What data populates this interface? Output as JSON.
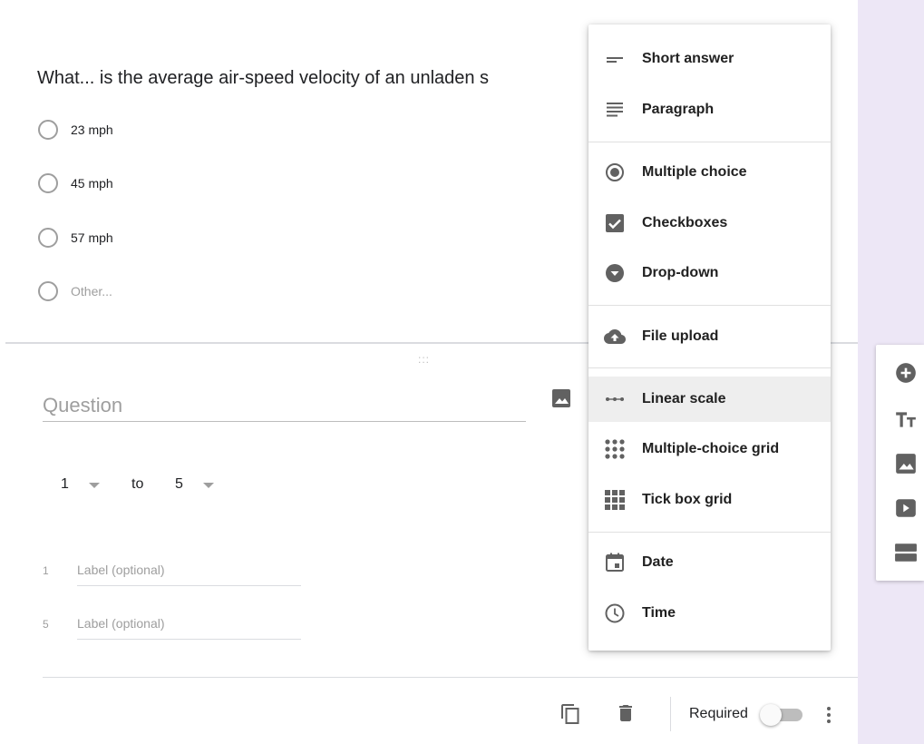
{
  "previous_question": {
    "title": "What... is the average air-speed velocity of an unladen s",
    "options": [
      {
        "label": "23 mph"
      },
      {
        "label": "45 mph"
      },
      {
        "label": "57 mph"
      },
      {
        "label": "Other..."
      }
    ]
  },
  "editing_question": {
    "drag_handle": ":::",
    "title_placeholder": "Question",
    "scale": {
      "from": "1",
      "to_label": "to",
      "to": "5"
    },
    "labels": [
      {
        "number": "1",
        "placeholder": "Label (optional)"
      },
      {
        "number": "5",
        "placeholder": "Label (optional)"
      }
    ],
    "footer": {
      "required_label": "Required",
      "required_on": false
    }
  },
  "type_menu": {
    "items": [
      {
        "label": "Short answer",
        "icon": "short-answer-icon"
      },
      {
        "label": "Paragraph",
        "icon": "paragraph-icon"
      },
      {
        "label": "Multiple choice",
        "icon": "radio-icon"
      },
      {
        "label": "Checkboxes",
        "icon": "checkbox-icon"
      },
      {
        "label": "Drop-down",
        "icon": "dropdown-icon"
      },
      {
        "label": "File upload",
        "icon": "cloud-upload-icon"
      },
      {
        "label": "Linear scale",
        "icon": "linear-scale-icon",
        "selected": true
      },
      {
        "label": "Multiple-choice grid",
        "icon": "dot-grid-icon"
      },
      {
        "label": "Tick box grid",
        "icon": "tick-grid-icon"
      },
      {
        "label": "Date",
        "icon": "calendar-icon"
      },
      {
        "label": "Time",
        "icon": "clock-icon"
      }
    ]
  },
  "side_toolbar": {
    "icons": [
      "add-question-icon",
      "title-text-icon",
      "image-icon",
      "video-icon",
      "section-icon"
    ]
  },
  "colors": {
    "accent": "#673ab7",
    "background": "#ede7f6",
    "icon": "#616161"
  }
}
